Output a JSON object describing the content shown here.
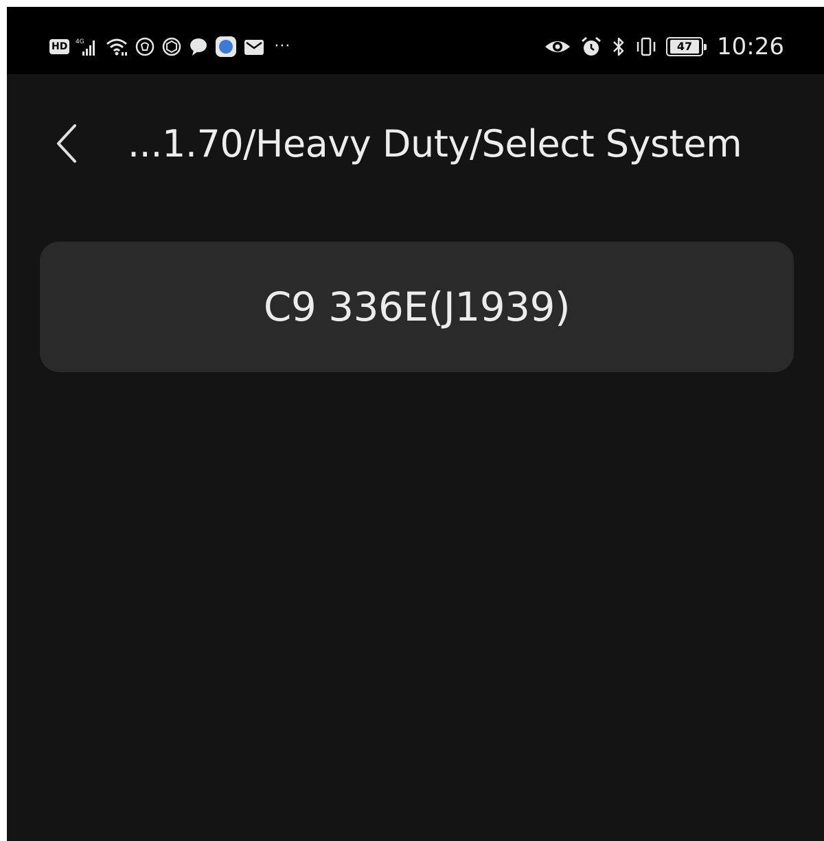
{
  "status_bar": {
    "left_icons": [
      "hd-icon",
      "signal-4g-icon",
      "wifi-icon",
      "app-notification-icon",
      "app-notification-icon",
      "chat-bubble-icon",
      "app-notification-icon",
      "mail-icon"
    ],
    "hd_label": "HD",
    "more_label": "···",
    "right_icons": [
      "eye-icon",
      "alarm-icon",
      "bluetooth-icon",
      "vibrate-icon",
      "battery-icon"
    ],
    "battery_level": "47",
    "time": "10:26"
  },
  "header": {
    "back_icon": "chevron-left-icon",
    "title": "...1.70/Heavy Duty/Select System"
  },
  "systems": [
    {
      "label": "C9 336E(J1939)"
    }
  ],
  "colors": {
    "background": "#141414",
    "status_bar": "#000000",
    "item_background": "#2a2a2a",
    "text": "#ececec",
    "accent_blue": "#3a7bd5"
  }
}
